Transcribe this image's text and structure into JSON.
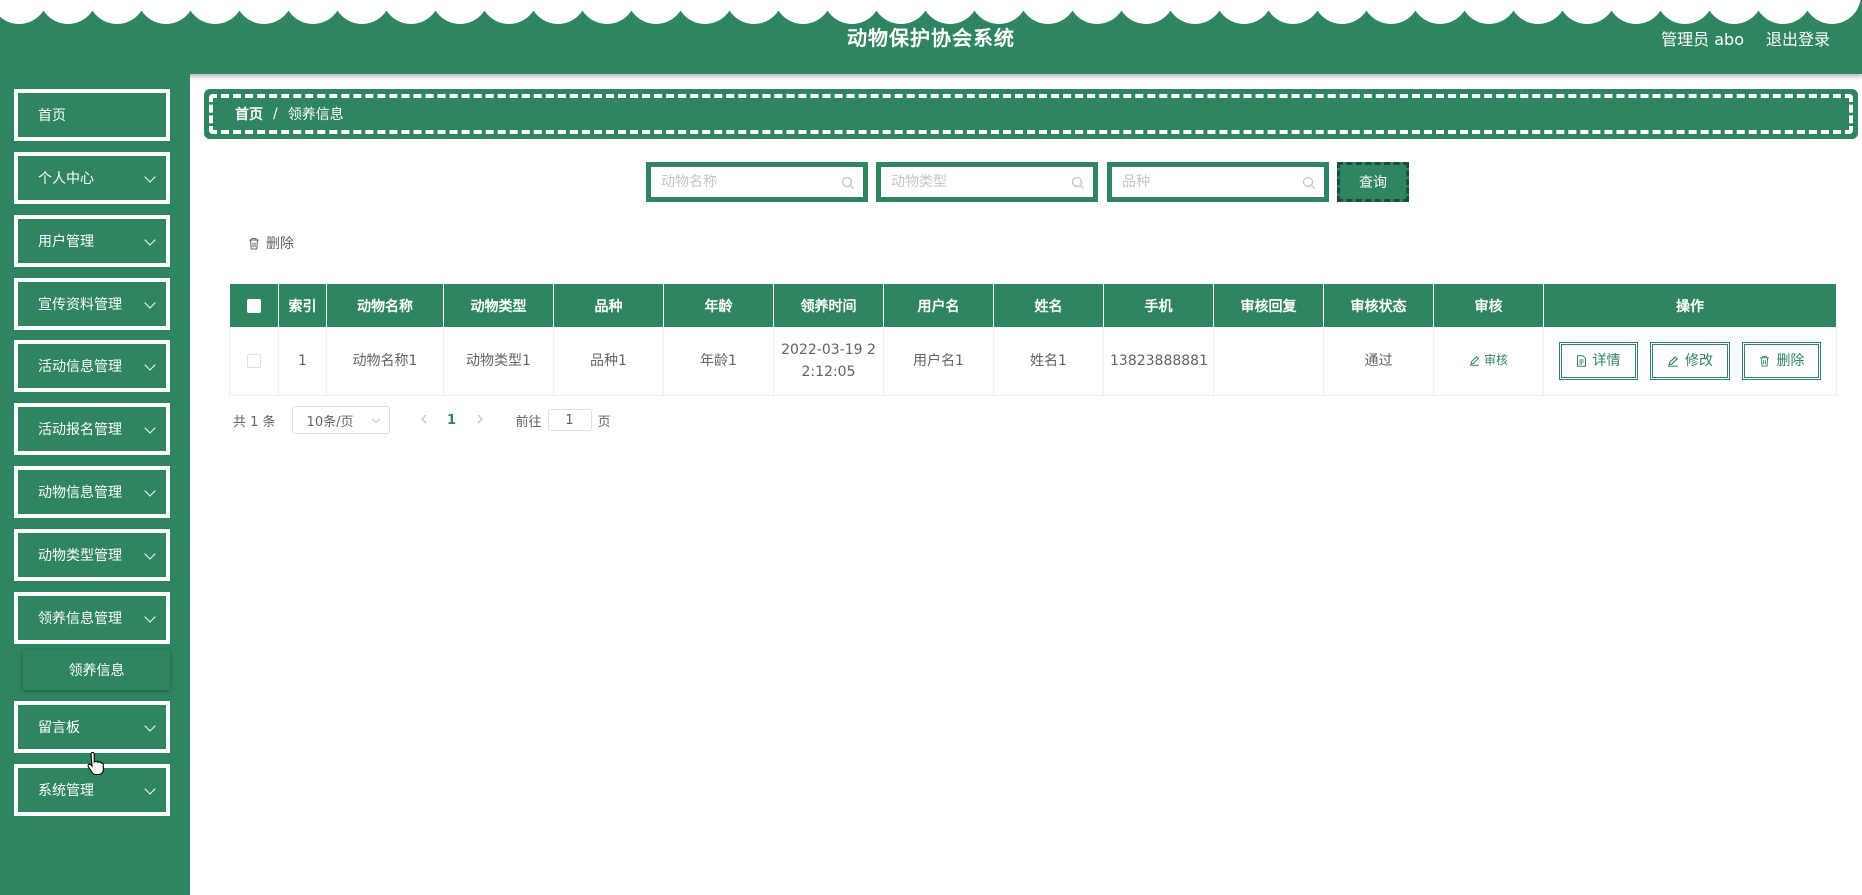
{
  "header": {
    "title": "动物保护协会系统",
    "user": "管理员 abo",
    "logout": "退出登录"
  },
  "sidebar": {
    "items": [
      {
        "label": "首页",
        "has_children": false
      },
      {
        "label": "个人中心",
        "has_children": true
      },
      {
        "label": "用户管理",
        "has_children": true
      },
      {
        "label": "宣传资料管理",
        "has_children": true
      },
      {
        "label": "活动信息管理",
        "has_children": true
      },
      {
        "label": "活动报名管理",
        "has_children": true
      },
      {
        "label": "动物信息管理",
        "has_children": true
      },
      {
        "label": "动物类型管理",
        "has_children": true
      },
      {
        "label": "领养信息管理",
        "has_children": true,
        "expanded": true
      },
      {
        "label": "留言板",
        "has_children": true
      },
      {
        "label": "系统管理",
        "has_children": true
      }
    ],
    "submenu": {
      "label": "领养信息"
    }
  },
  "breadcrumb": {
    "home": "首页",
    "separator": "/",
    "current": "领养信息"
  },
  "search": {
    "name_placeholder": "动物名称",
    "type_placeholder": "动物类型",
    "breed_placeholder": "品种",
    "button": "查询"
  },
  "toolbar": {
    "delete_label": "删除"
  },
  "table": {
    "columns": [
      "索引",
      "动物名称",
      "动物类型",
      "品种",
      "年龄",
      "领养时间",
      "用户名",
      "姓名",
      "手机",
      "审核回复",
      "审核状态",
      "审核",
      "操作"
    ],
    "rows": [
      {
        "index": "1",
        "name": "动物名称1",
        "type": "动物类型1",
        "breed": "品种1",
        "age": "年龄1",
        "time": "2022-03-19 22:12:05",
        "username": "用户名1",
        "realname": "姓名1",
        "phone": "13823888881",
        "reply": "",
        "status": "通过",
        "audit": "审核",
        "actions": {
          "detail": "详情",
          "edit": "修改",
          "delete": "删除"
        }
      }
    ]
  },
  "pagination": {
    "total": "共 1 条",
    "page_size": "10条/页",
    "current_page": "1",
    "goto_label": "前往",
    "goto_value": "1",
    "page_suffix": "页"
  },
  "colors": {
    "primary": "#2e8560",
    "white": "#ffffff",
    "text": "#606266",
    "placeholder": "#c0c4cc"
  },
  "icons": [
    "search-icon",
    "chevron-down-icon",
    "trash-icon",
    "edit-icon",
    "document-icon",
    "chevron-left-icon",
    "chevron-right-icon",
    "hand-cursor-icon"
  ]
}
